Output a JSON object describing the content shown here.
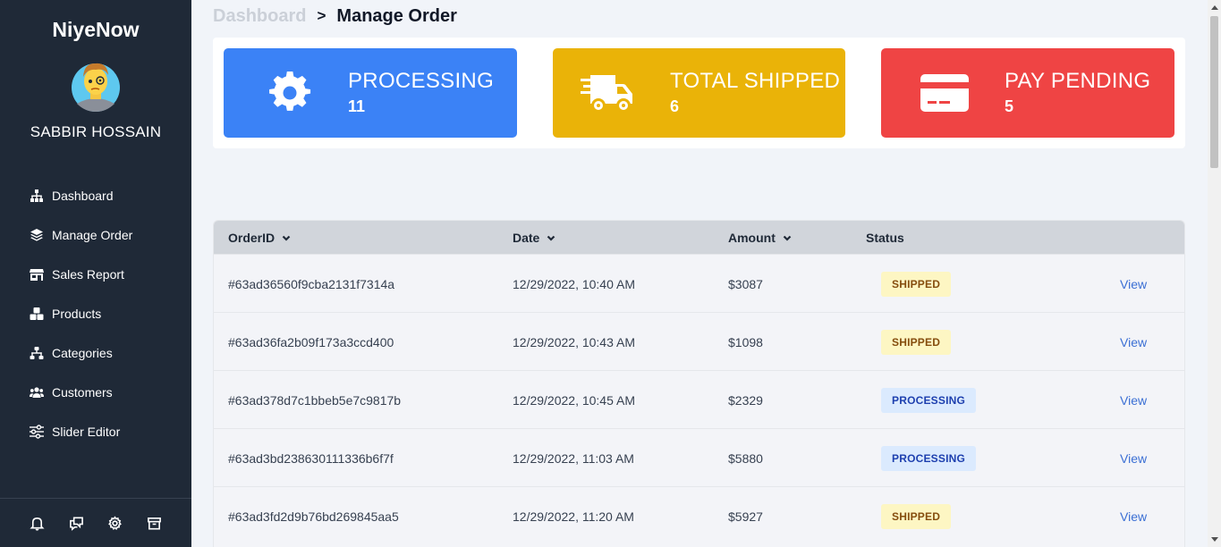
{
  "sidebar": {
    "brand": "NiyeNow",
    "username": "SABBIR HOSSAIN",
    "items": [
      {
        "label": "Dashboard",
        "icon": "sitemap-icon"
      },
      {
        "label": "Manage Order",
        "icon": "layers-icon"
      },
      {
        "label": "Sales Report",
        "icon": "store-icon"
      },
      {
        "label": "Products",
        "icon": "cubes-icon"
      },
      {
        "label": "Categories",
        "icon": "hierarchy-icon"
      },
      {
        "label": "Customers",
        "icon": "users-icon"
      },
      {
        "label": "Slider Editor",
        "icon": "sliders-icon"
      }
    ],
    "footer_icons": [
      "bell-icon",
      "chat-icon",
      "gear-icon",
      "archive-icon"
    ]
  },
  "breadcrumb": {
    "parent": "Dashboard",
    "separator": ">",
    "current": "Manage Order"
  },
  "stats": [
    {
      "label": "PROCESSING",
      "value": "11",
      "color": "#3b82f6",
      "icon": "gear-icon"
    },
    {
      "label": "TOTAL SHIPPED",
      "value": "6",
      "color": "#eab308",
      "icon": "truck-icon"
    },
    {
      "label": "PAY PENDING",
      "value": "5",
      "color": "#ef4444",
      "icon": "credit-card-icon"
    }
  ],
  "table": {
    "columns": [
      "OrderID",
      "Date",
      "Amount",
      "Status"
    ],
    "rows": [
      {
        "id": "#63ad36560f9cba2131f7314a",
        "date": "12/29/2022, 10:40 AM",
        "amount": "$3087",
        "status": "SHIPPED",
        "action": "View"
      },
      {
        "id": "#63ad36fa2b09f173a3ccd400",
        "date": "12/29/2022, 10:43 AM",
        "amount": "$1098",
        "status": "SHIPPED",
        "action": "View"
      },
      {
        "id": "#63ad378d7c1bbeb5e7c9817b",
        "date": "12/29/2022, 10:45 AM",
        "amount": "$2329",
        "status": "PROCESSING",
        "action": "View"
      },
      {
        "id": "#63ad3bd238630111336b6f7f",
        "date": "12/29/2022, 11:03 AM",
        "amount": "$5880",
        "status": "PROCESSING",
        "action": "View"
      },
      {
        "id": "#63ad3fd2d9b76bd269845aa5",
        "date": "12/29/2022, 11:20 AM",
        "amount": "$5927",
        "status": "SHIPPED",
        "action": "View"
      }
    ]
  },
  "colors": {
    "sidebar_bg": "#1f2937",
    "shipped_badge_bg": "#fdf6c3",
    "processing_badge_bg": "#dbeafe",
    "link": "#3b6fd4"
  }
}
